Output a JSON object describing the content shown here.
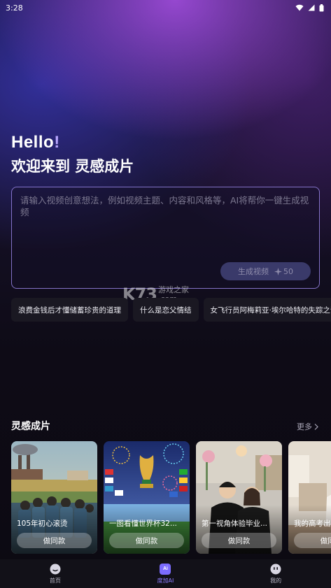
{
  "status_bar": {
    "time": "3:28"
  },
  "greeting": {
    "hello": "Hello",
    "hello_mark": "!",
    "welcome": "欢迎来到 灵感成片"
  },
  "prompt": {
    "placeholder": "请输入视频创意想法，例如视频主题、内容和风格等，AI将帮你一键生成视频",
    "generate_label": "生成视频",
    "cost": "50"
  },
  "suggestions": [
    "浪费金钱后才懂储蓄珍贵的道理",
    "什么是恋父情结",
    "女飞行员阿梅莉亚·埃尔哈特的失踪之谜"
  ],
  "watermark": {
    "big": "K73",
    "line1": "游戏之家",
    "line2": ".com"
  },
  "section": {
    "title": "灵感成片",
    "more": "更多"
  },
  "cards": [
    {
      "title": "105年初心滚烫",
      "button": "做同款"
    },
    {
      "title": "一图看懂世界杯32...",
      "button": "做同款"
    },
    {
      "title": "第一视角体验毕业...",
      "button": "做同款"
    },
    {
      "title": "我的高考出...",
      "button": "做同款"
    }
  ],
  "nav": {
    "home": "首页",
    "ai": "度加AI",
    "ai_badge": "Ai",
    "mine": "我的"
  },
  "colors": {
    "accent": "#8d7cff",
    "border": "#aa96ff"
  }
}
